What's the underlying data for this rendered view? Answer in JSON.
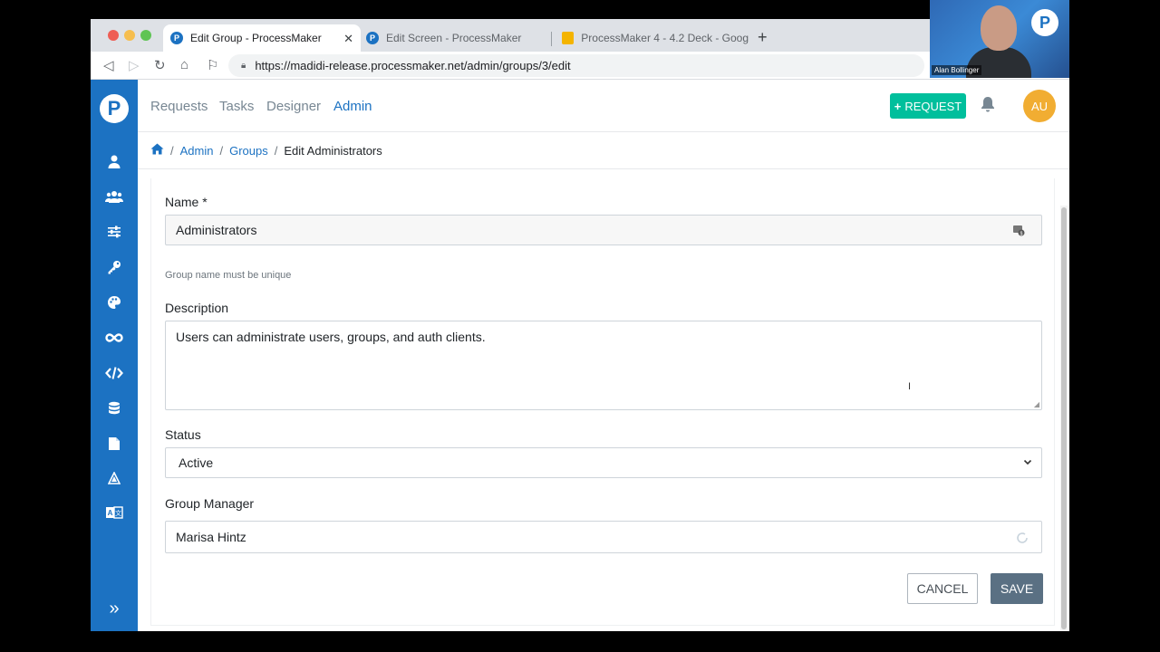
{
  "browser": {
    "tabs": [
      {
        "title": "Edit Group - ProcessMaker",
        "active": true
      },
      {
        "title": "Edit Screen - ProcessMaker",
        "active": false
      },
      {
        "title": "ProcessMaker 4 - 4.2 Deck - Goog",
        "active": false
      }
    ],
    "url": "https://madidi-release.processmaker.net/admin/groups/3/edit"
  },
  "nav": {
    "items": [
      "Requests",
      "Tasks",
      "Designer",
      "Admin"
    ],
    "active": "Admin",
    "request_button": "REQUEST",
    "avatar_initials": "AU",
    "brand_color": "#1c72c2",
    "request_color": "#00bf9c",
    "avatar_color": "#f1ad32"
  },
  "sidebar": {
    "icons": [
      "user-icon",
      "users-icon",
      "sliders-icon",
      "key-icon",
      "palette-icon",
      "infinity-icon",
      "code-icon",
      "database-icon",
      "file-icon",
      "triangle-icon",
      "translate-icon"
    ],
    "collapse_icon": "chevron-double-right-icon"
  },
  "breadcrumb": {
    "items": [
      "Admin",
      "Groups"
    ],
    "current": "Edit Administrators"
  },
  "form": {
    "name_label": "Name *",
    "name_value": "Administrators",
    "name_help": "Group name must be unique",
    "description_label": "Description",
    "description_value": "Users can administrate users, groups, and auth clients.",
    "status_label": "Status",
    "status_value": "Active",
    "manager_label": "Group Manager",
    "manager_value": "Marisa Hintz",
    "cancel_label": "CANCEL",
    "save_label": "SAVE"
  },
  "webcam": {
    "name": "Alan Bollinger"
  }
}
